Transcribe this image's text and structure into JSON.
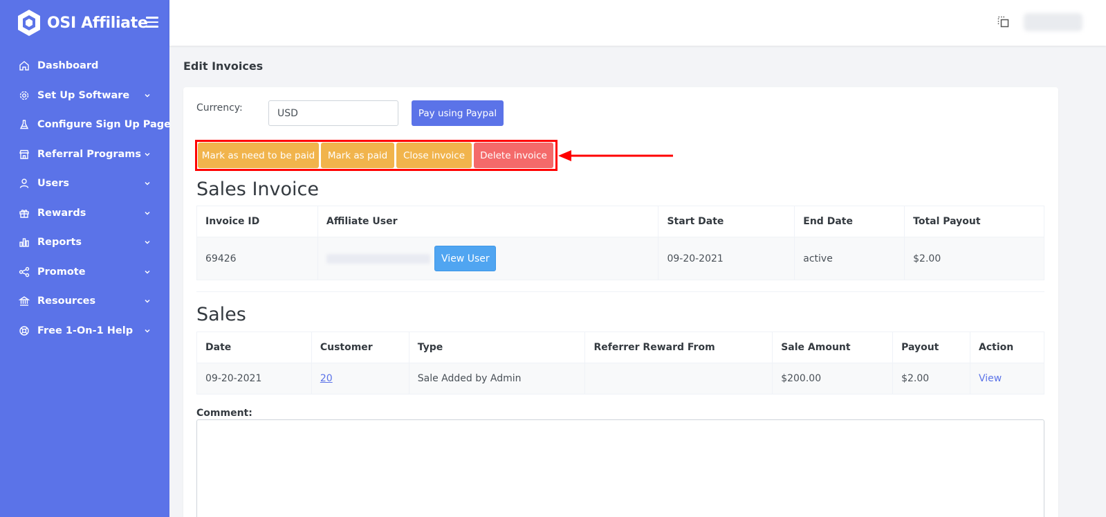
{
  "brand": {
    "name": "OSI Affiliate"
  },
  "sidebar": {
    "items": [
      {
        "label": "Dashboard",
        "icon": "home-icon",
        "expandable": false
      },
      {
        "label": "Set Up Software",
        "icon": "gear-icon",
        "expandable": true
      },
      {
        "label": "Configure Sign Up Page",
        "icon": "flask-icon",
        "expandable": false
      },
      {
        "label": "Referral Programs",
        "icon": "store-icon",
        "expandable": true
      },
      {
        "label": "Users",
        "icon": "user-icon",
        "expandable": true
      },
      {
        "label": "Rewards",
        "icon": "gift-icon",
        "expandable": true
      },
      {
        "label": "Reports",
        "icon": "bar-chart-icon",
        "expandable": true
      },
      {
        "label": "Promote",
        "icon": "share-icon",
        "expandable": true
      },
      {
        "label": "Resources",
        "icon": "bank-icon",
        "expandable": true
      },
      {
        "label": "Free 1-On-1 Help",
        "icon": "lifebuoy-icon",
        "expandable": true
      }
    ]
  },
  "page": {
    "title": "Edit Invoices"
  },
  "currency": {
    "label": "Currency:",
    "value": "USD"
  },
  "buttons": {
    "pay_paypal": "Pay using Paypal",
    "mark_need_paid": "Mark as need to be paid",
    "mark_paid": "Mark as paid",
    "close_invoice": "Close invoice",
    "delete_invoice": "Delete invoice",
    "view_user": "View User"
  },
  "colors": {
    "primary": "#5b73e8",
    "warning": "#f1b44c",
    "danger": "#f46a6a",
    "info": "#50a5f1",
    "highlight": "#ff0000"
  },
  "invoice": {
    "title": "Sales Invoice",
    "headers": [
      "Invoice ID",
      "Affiliate User",
      "Start Date",
      "End Date",
      "Total Payout"
    ],
    "row": {
      "invoice_id": "69426",
      "start_date": "09-20-2021",
      "end_date": "active",
      "total_payout": "$2.00"
    }
  },
  "sales": {
    "title": "Sales",
    "headers": [
      "Date",
      "Customer",
      "Type",
      "Referrer Reward From",
      "Sale Amount",
      "Payout",
      "Action"
    ],
    "row": {
      "date": "09-20-2021",
      "customer": "20",
      "type": "Sale Added by Admin",
      "referrer_reward_from": "",
      "sale_amount": "$200.00",
      "payout": "$2.00",
      "action": "View"
    }
  },
  "comment": {
    "label": "Comment:",
    "value": ""
  }
}
